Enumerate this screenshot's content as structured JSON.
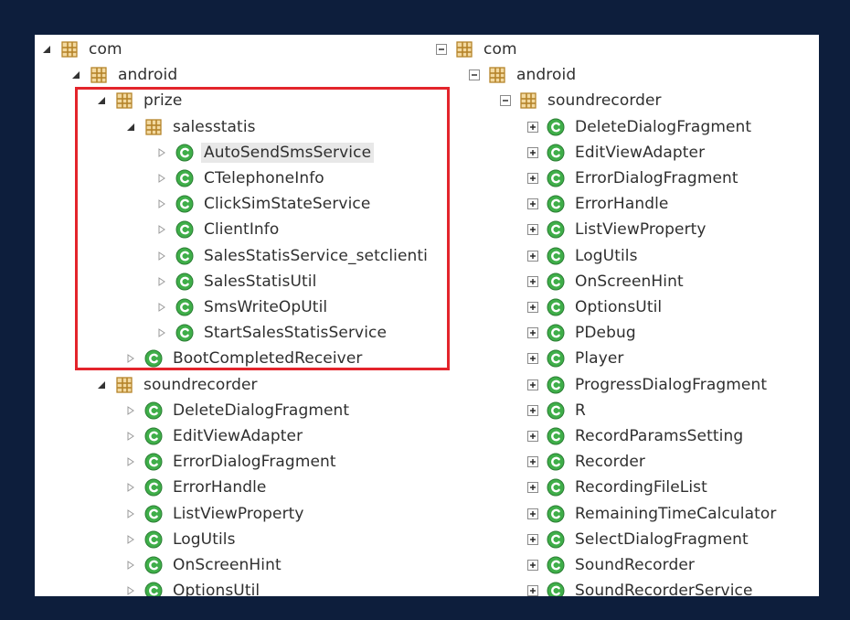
{
  "colors": {
    "frame": "#0d1e3c",
    "panel": "#ffffff",
    "highlight": "#e3242b",
    "class_icon": "#3fae49",
    "package_icon": "#b5842a"
  },
  "left_tree": {
    "rows": [
      {
        "label": "com",
        "type": "package",
        "toggle": "expanded-arrow",
        "level": 0
      },
      {
        "label": "android",
        "type": "package",
        "toggle": "expanded-arrow",
        "level": 1
      },
      {
        "label": "prize",
        "type": "package",
        "toggle": "expanded-arrow",
        "level": 2
      },
      {
        "label": "salesstatis",
        "type": "package",
        "toggle": "expanded-arrow",
        "level": 3
      },
      {
        "label": "AutoSendSmsService",
        "type": "class",
        "toggle": "collapsed-arrow",
        "level": 4,
        "selected": true
      },
      {
        "label": "CTelephoneInfo",
        "type": "class",
        "toggle": "collapsed-arrow",
        "level": 4
      },
      {
        "label": "ClickSimStateService",
        "type": "class",
        "toggle": "collapsed-arrow",
        "level": 4
      },
      {
        "label": "ClientInfo",
        "type": "class",
        "toggle": "collapsed-arrow",
        "level": 4
      },
      {
        "label": "SalesStatisService_setclienti",
        "type": "class",
        "toggle": "collapsed-arrow",
        "level": 4
      },
      {
        "label": "SalesStatisUtil",
        "type": "class",
        "toggle": "collapsed-arrow",
        "level": 4
      },
      {
        "label": "SmsWriteOpUtil",
        "type": "class",
        "toggle": "collapsed-arrow",
        "level": 4
      },
      {
        "label": "StartSalesStatisService",
        "type": "class",
        "toggle": "collapsed-arrow",
        "level": 4
      },
      {
        "label": "BootCompletedReceiver",
        "type": "class",
        "toggle": "collapsed-arrow",
        "level": 3
      },
      {
        "label": "soundrecorder",
        "type": "package",
        "toggle": "expanded-arrow",
        "level": 2
      },
      {
        "label": "DeleteDialogFragment",
        "type": "class",
        "toggle": "collapsed-arrow",
        "level": 3
      },
      {
        "label": "EditViewAdapter",
        "type": "class",
        "toggle": "collapsed-arrow",
        "level": 3
      },
      {
        "label": "ErrorDialogFragment",
        "type": "class",
        "toggle": "collapsed-arrow",
        "level": 3
      },
      {
        "label": "ErrorHandle",
        "type": "class",
        "toggle": "collapsed-arrow",
        "level": 3
      },
      {
        "label": "ListViewProperty",
        "type": "class",
        "toggle": "collapsed-arrow",
        "level": 3
      },
      {
        "label": "LogUtils",
        "type": "class",
        "toggle": "collapsed-arrow",
        "level": 3
      },
      {
        "label": "OnScreenHint",
        "type": "class",
        "toggle": "collapsed-arrow",
        "level": 3
      },
      {
        "label": "OptionsUtil",
        "type": "class",
        "toggle": "collapsed-arrow",
        "level": 3
      }
    ]
  },
  "right_tree": {
    "rows": [
      {
        "label": "com",
        "type": "package",
        "toggle": "minus-box",
        "level": 0
      },
      {
        "label": "android",
        "type": "package",
        "toggle": "minus-box",
        "level": 1
      },
      {
        "label": "soundrecorder",
        "type": "package",
        "toggle": "minus-box",
        "level": 2
      },
      {
        "label": "DeleteDialogFragment",
        "type": "class",
        "toggle": "plus-box",
        "level": 3
      },
      {
        "label": "EditViewAdapter",
        "type": "class",
        "toggle": "plus-box",
        "level": 3
      },
      {
        "label": "ErrorDialogFragment",
        "type": "class",
        "toggle": "plus-box",
        "level": 3
      },
      {
        "label": "ErrorHandle",
        "type": "class",
        "toggle": "plus-box",
        "level": 3
      },
      {
        "label": "ListViewProperty",
        "type": "class",
        "toggle": "plus-box",
        "level": 3
      },
      {
        "label": "LogUtils",
        "type": "class",
        "toggle": "plus-box",
        "level": 3
      },
      {
        "label": "OnScreenHint",
        "type": "class",
        "toggle": "plus-box",
        "level": 3
      },
      {
        "label": "OptionsUtil",
        "type": "class",
        "toggle": "plus-box",
        "level": 3
      },
      {
        "label": "PDebug",
        "type": "class",
        "toggle": "plus-box",
        "level": 3
      },
      {
        "label": "Player",
        "type": "class",
        "toggle": "plus-box",
        "level": 3
      },
      {
        "label": "ProgressDialogFragment",
        "type": "class",
        "toggle": "plus-box",
        "level": 3
      },
      {
        "label": "R",
        "type": "class",
        "toggle": "plus-box",
        "level": 3
      },
      {
        "label": "RecordParamsSetting",
        "type": "class",
        "toggle": "plus-box",
        "level": 3
      },
      {
        "label": "Recorder",
        "type": "class",
        "toggle": "plus-box",
        "level": 3
      },
      {
        "label": "RecordingFileList",
        "type": "class",
        "toggle": "plus-box",
        "level": 3
      },
      {
        "label": "RemainingTimeCalculator",
        "type": "class",
        "toggle": "plus-box",
        "level": 3
      },
      {
        "label": "SelectDialogFragment",
        "type": "class",
        "toggle": "plus-box",
        "level": 3
      },
      {
        "label": "SoundRecorder",
        "type": "class",
        "toggle": "plus-box",
        "level": 3
      },
      {
        "label": "SoundRecorderService",
        "type": "class",
        "toggle": "plus-box",
        "level": 3
      }
    ]
  }
}
